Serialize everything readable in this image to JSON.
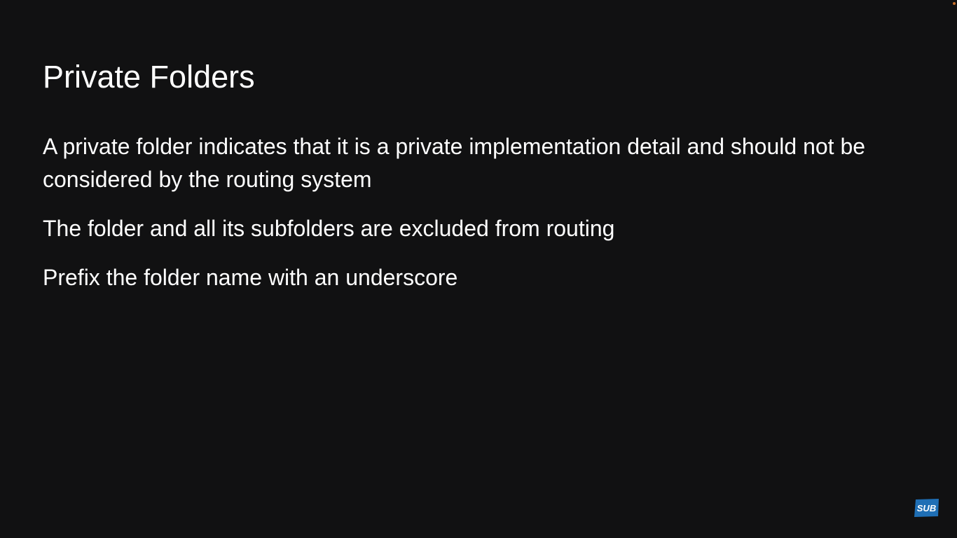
{
  "slide": {
    "title": "Private Folders",
    "bullets": [
      "A private folder indicates that it is a private implementation detail and should not be considered by the routing system",
      "The folder and all its subfolders are excluded from routing",
      "Prefix the folder name with an underscore"
    ]
  },
  "badge": {
    "label": "SUB",
    "icon": "subscribe-badge-icon",
    "color": "#1f6fb5"
  },
  "colors": {
    "background": "#111112",
    "text": "#ffffff",
    "corner_dot": "#c8702a"
  }
}
